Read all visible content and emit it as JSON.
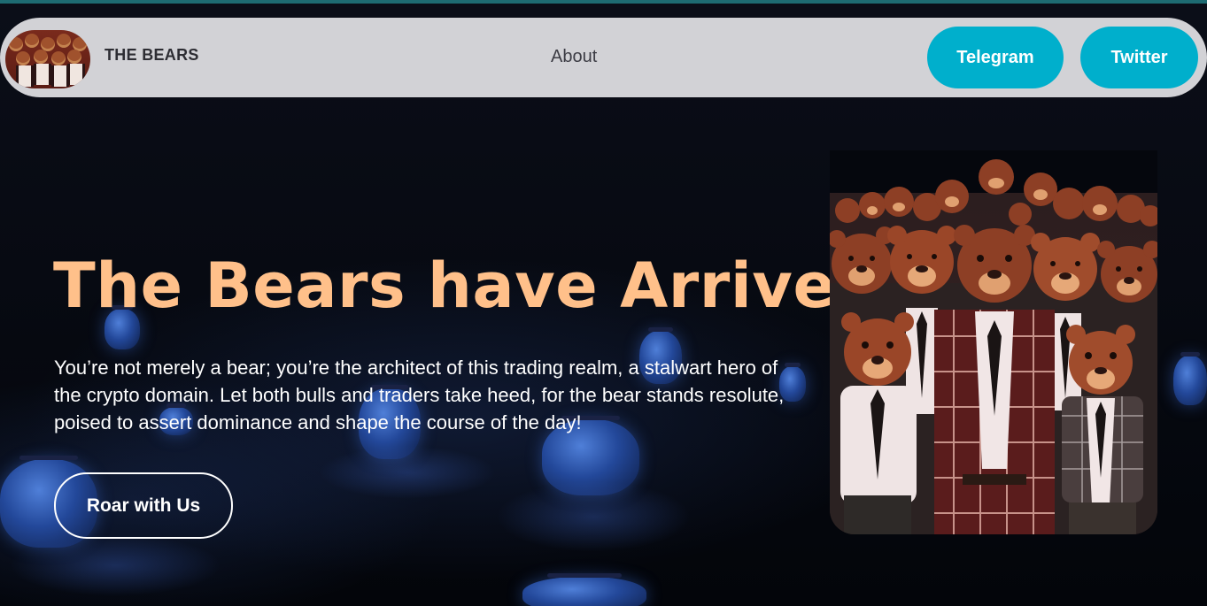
{
  "nav": {
    "brand": "THE BEARS",
    "links": [
      {
        "label": "About"
      }
    ],
    "buttons": [
      {
        "label": "Telegram"
      },
      {
        "label": "Twitter"
      }
    ]
  },
  "hero": {
    "title": "The Bears have Arrived",
    "description": "You’re not merely a bear; you’re the architect of this trading realm, a stalwart hero of the crypto domain. Let both bulls and traders take heed, for the bear stands resolute, poised to assert dominance and shape the course of the day!",
    "cta": "Roar with Us"
  },
  "colors": {
    "accent": "#00afcc",
    "title": "#ffc08a",
    "nav_bg": "#d2d2d6",
    "page_bg": "#05070d"
  },
  "icons": {
    "logo": "bears-crowd-logo",
    "hero_image": "bears-in-suits-illustration"
  }
}
